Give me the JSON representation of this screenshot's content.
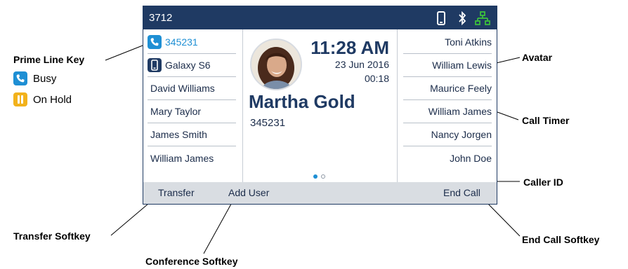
{
  "screen": {
    "extension": "3712",
    "colors": {
      "header": "#1f3a63",
      "accent": "#1e8fd4",
      "softkey_bar": "#d9dde2",
      "hold": "#f2b21c"
    },
    "status_icons": [
      "mobile-phone-icon",
      "bluetooth-icon",
      "network-icon"
    ],
    "left_keys": [
      {
        "label": "345231",
        "icon": "phone-busy-icon",
        "state": "busy"
      },
      {
        "label": "Galaxy S6",
        "icon": "mobile-device-icon"
      },
      {
        "label": "David Williams"
      },
      {
        "label": "Mary Taylor"
      },
      {
        "label": "James Smith"
      },
      {
        "label": "William James"
      }
    ],
    "right_keys": [
      "Toni Atkins",
      "William Lewis",
      "Maurice Feely",
      "William James",
      "Nancy Jorgen",
      "John Doe"
    ],
    "call": {
      "time": "11:28 AM",
      "date": "23 Jun 2016",
      "timer": "00:18",
      "caller_name": "Martha Gold",
      "caller_number": "345231"
    },
    "softkeys": {
      "transfer": "Transfer",
      "add_user": "Add User",
      "end_call": "End Call"
    }
  },
  "annotations": {
    "prime_line_key": "Prime Line Key",
    "busy": "Busy",
    "on_hold": "On Hold",
    "avatar": "Avatar",
    "call_timer": "Call Timer",
    "caller_id": "Caller ID",
    "transfer_softkey": "Transfer Softkey",
    "conference_softkey": "Conference Softkey",
    "end_call_softkey": "End Call Softkey"
  }
}
